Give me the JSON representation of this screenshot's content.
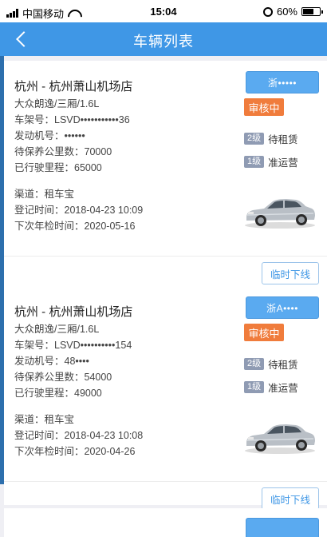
{
  "status_bar": {
    "carrier": "中国移动",
    "time": "15:04",
    "battery": "60%"
  },
  "nav": {
    "title": "车辆列表"
  },
  "vehicles": [
    {
      "store": "杭州 - 杭州萧山机场店",
      "model": "大众朗逸/三厢/1.6L",
      "vin": "车架号：LSVD•••••••••••36",
      "engine": "发动机号：••••••",
      "maintenance": "待保养公里数：70000",
      "mileage": "已行驶里程：65000",
      "channel": "渠道：租车宝",
      "register": "登记时间：2018-04-23 10:09",
      "inspection": "下次年检时间：2020-05-16",
      "plate": "浙•••••",
      "audit": "审核中",
      "level1_tag": "2级",
      "level1_text": "待租赁",
      "level2_tag": "1级",
      "level2_text": "准运营",
      "action": "临时下线"
    },
    {
      "store": "杭州 - 杭州萧山机场店",
      "model": "大众朗逸/三厢/1.6L",
      "vin": "车架号：LSVD••••••••••154",
      "engine": "发动机号：48••••",
      "maintenance": "待保养公里数：54000",
      "mileage": "已行驶里程：49000",
      "channel": "渠道：租车宝",
      "register": "登记时间：2018-04-23 10:08",
      "inspection": "下次年检时间：2020-04-26",
      "plate": "浙A••••",
      "audit": "审核中",
      "level1_tag": "2级",
      "level1_text": "待租赁",
      "level2_tag": "1级",
      "level2_text": "准运营",
      "action": "临时下线"
    }
  ],
  "colors": {
    "nav": "#3f97e6",
    "audit": "#f07c3c",
    "plate": "#5aaaf0",
    "tag": "#8f9bb3"
  },
  "icons": {
    "back": "chevron-left-icon",
    "car": "sedan-car-icon"
  }
}
